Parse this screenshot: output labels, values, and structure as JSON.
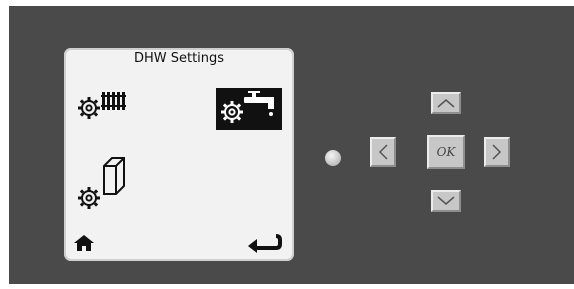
{
  "screen": {
    "title": "DHW Settings",
    "items": [
      {
        "icon": "gear-radiator-icon",
        "selected": false
      },
      {
        "icon": "gear-tap-icon",
        "selected": true
      },
      {
        "icon": "gear-tank-icon",
        "selected": false
      }
    ],
    "footer": {
      "home_icon": "home-icon",
      "back_icon": "back-arrow-icon"
    }
  },
  "controls": {
    "led_icon": "status-led",
    "buttons": {
      "up_icon": "chevron-up-icon",
      "down_icon": "chevron-down-icon",
      "left_icon": "chevron-left-icon",
      "right_icon": "chevron-right-icon",
      "ok_label": "OK"
    }
  },
  "colors": {
    "panel": "#4a4a4a",
    "screen": "#f2f2f2",
    "button": "#c7c7c7",
    "selected_item": "#111111"
  }
}
